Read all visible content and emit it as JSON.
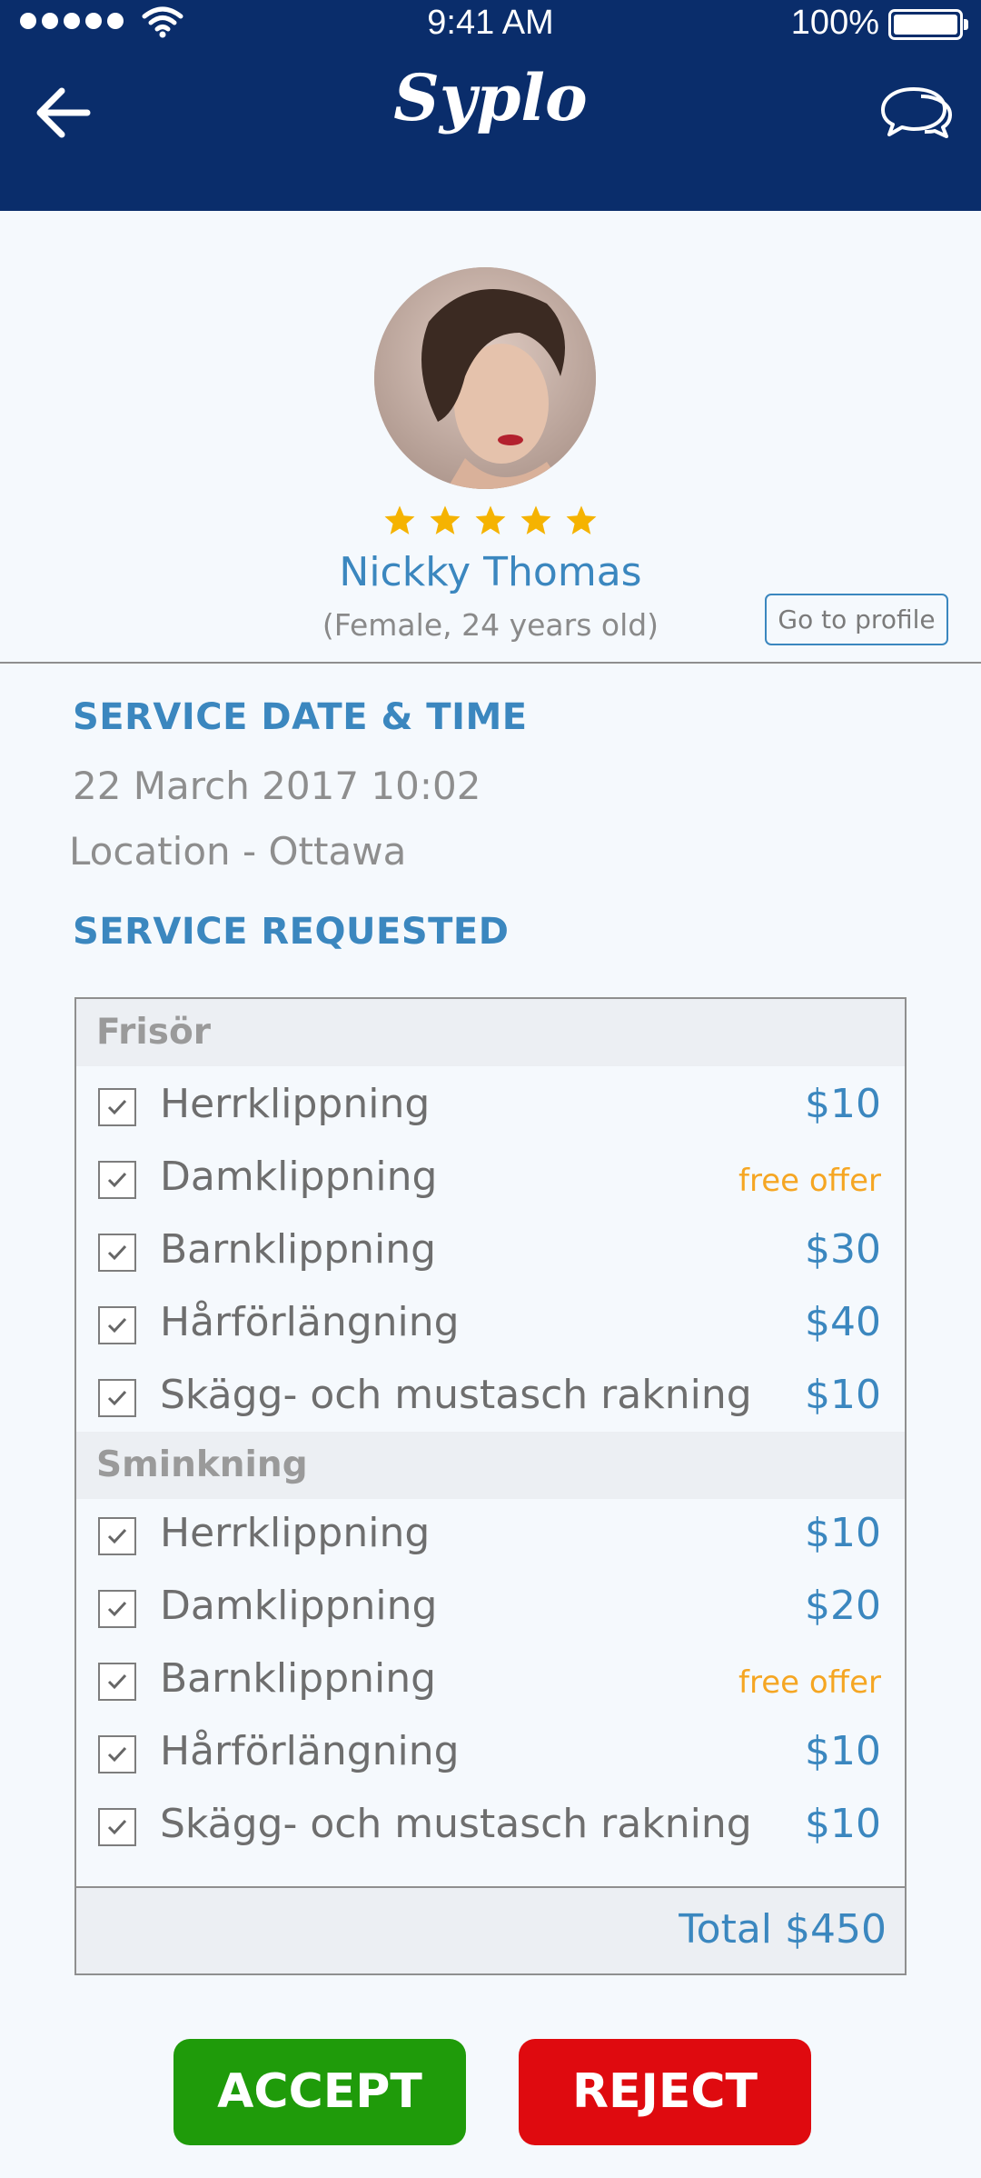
{
  "status_bar": {
    "time": "9:41 AM",
    "battery": "100%"
  },
  "header": {
    "app_title": "Syplo",
    "back_icon": "arrow-left-icon",
    "chat_icon": "chat-bubbles-icon"
  },
  "profile": {
    "name": "Nickky Thomas",
    "details": "(Female, 24 years old)",
    "rating": 5,
    "go_to_profile_label": "Go to profile"
  },
  "service": {
    "date_time_heading": "SERVICE DATE & TIME",
    "date_time": "22 March 2017 10:02",
    "location": "Location - Ottawa",
    "requested_heading": "SERVICE REQUESTED"
  },
  "groups": [
    {
      "title": "Frisör",
      "items": [
        {
          "label": "Herrklippning",
          "price": "$10",
          "checked": true
        },
        {
          "label": "Damklippning",
          "price": "free offer",
          "checked": true
        },
        {
          "label": "Barnklippning",
          "price": "$30",
          "checked": true
        },
        {
          "label": "Hårförlängning",
          "price": "$40",
          "checked": true
        },
        {
          "label": "Skägg- och mustasch rakning",
          "price": "$10",
          "checked": true
        }
      ]
    },
    {
      "title": "Sminkning",
      "items": [
        {
          "label": "Herrklippning",
          "price": "$10",
          "checked": true
        },
        {
          "label": "Damklippning",
          "price": "$20",
          "checked": true
        },
        {
          "label": "Barnklippning",
          "price": "free offer",
          "checked": true
        },
        {
          "label": "Hårförlängning",
          "price": "$10",
          "checked": true
        },
        {
          "label": "Skägg- och mustasch rakning",
          "price": "$10",
          "checked": true
        }
      ]
    }
  ],
  "total": "Total $450",
  "actions": {
    "accept": "ACCEPT",
    "reject": "REJECT"
  },
  "colors": {
    "header_bg": "#0a2d6b",
    "accent_blue": "#3b87bf",
    "free_offer": "#f5a623",
    "accept": "#1f9b0a",
    "reject": "#df0a0f",
    "star": "#f5b301"
  }
}
